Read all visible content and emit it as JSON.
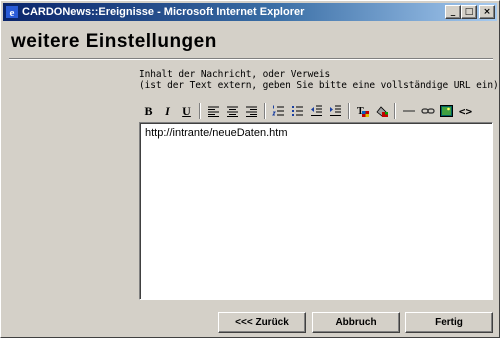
{
  "window": {
    "title": "CARDONews::Ereignisse - Microsoft Internet Explorer",
    "minimize_glyph": "_",
    "maximize_glyph": "□",
    "close_glyph": "×"
  },
  "page": {
    "heading": "weitere Einstellungen",
    "label_line1": "Inhalt der Nachricht, oder Verweis",
    "label_line2": "(ist der Text extern, geben Sie bitte eine vollständige URL ein)"
  },
  "toolbar": {
    "bold": "B",
    "italic": "I",
    "underline": "U",
    "source": "<>"
  },
  "editor": {
    "content": "http://intrante/neueDaten.htm"
  },
  "buttons": {
    "back": "<<< Zurück",
    "cancel": "Abbruch",
    "finish": "Fertig"
  }
}
